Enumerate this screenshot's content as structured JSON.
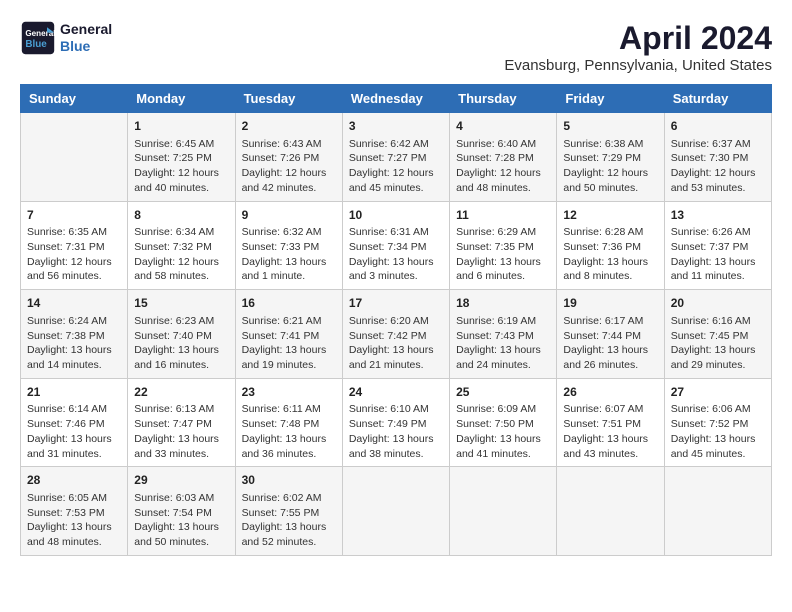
{
  "header": {
    "logo_line1": "General",
    "logo_line2": "Blue",
    "title": "April 2024",
    "subtitle": "Evansburg, Pennsylvania, United States"
  },
  "columns": [
    "Sunday",
    "Monday",
    "Tuesday",
    "Wednesday",
    "Thursday",
    "Friday",
    "Saturday"
  ],
  "weeks": [
    [
      {
        "day": "",
        "info": ""
      },
      {
        "day": "1",
        "info": "Sunrise: 6:45 AM\nSunset: 7:25 PM\nDaylight: 12 hours\nand 40 minutes."
      },
      {
        "day": "2",
        "info": "Sunrise: 6:43 AM\nSunset: 7:26 PM\nDaylight: 12 hours\nand 42 minutes."
      },
      {
        "day": "3",
        "info": "Sunrise: 6:42 AM\nSunset: 7:27 PM\nDaylight: 12 hours\nand 45 minutes."
      },
      {
        "day": "4",
        "info": "Sunrise: 6:40 AM\nSunset: 7:28 PM\nDaylight: 12 hours\nand 48 minutes."
      },
      {
        "day": "5",
        "info": "Sunrise: 6:38 AM\nSunset: 7:29 PM\nDaylight: 12 hours\nand 50 minutes."
      },
      {
        "day": "6",
        "info": "Sunrise: 6:37 AM\nSunset: 7:30 PM\nDaylight: 12 hours\nand 53 minutes."
      }
    ],
    [
      {
        "day": "7",
        "info": "Sunrise: 6:35 AM\nSunset: 7:31 PM\nDaylight: 12 hours\nand 56 minutes."
      },
      {
        "day": "8",
        "info": "Sunrise: 6:34 AM\nSunset: 7:32 PM\nDaylight: 12 hours\nand 58 minutes."
      },
      {
        "day": "9",
        "info": "Sunrise: 6:32 AM\nSunset: 7:33 PM\nDaylight: 13 hours\nand 1 minute."
      },
      {
        "day": "10",
        "info": "Sunrise: 6:31 AM\nSunset: 7:34 PM\nDaylight: 13 hours\nand 3 minutes."
      },
      {
        "day": "11",
        "info": "Sunrise: 6:29 AM\nSunset: 7:35 PM\nDaylight: 13 hours\nand 6 minutes."
      },
      {
        "day": "12",
        "info": "Sunrise: 6:28 AM\nSunset: 7:36 PM\nDaylight: 13 hours\nand 8 minutes."
      },
      {
        "day": "13",
        "info": "Sunrise: 6:26 AM\nSunset: 7:37 PM\nDaylight: 13 hours\nand 11 minutes."
      }
    ],
    [
      {
        "day": "14",
        "info": "Sunrise: 6:24 AM\nSunset: 7:38 PM\nDaylight: 13 hours\nand 14 minutes."
      },
      {
        "day": "15",
        "info": "Sunrise: 6:23 AM\nSunset: 7:40 PM\nDaylight: 13 hours\nand 16 minutes."
      },
      {
        "day": "16",
        "info": "Sunrise: 6:21 AM\nSunset: 7:41 PM\nDaylight: 13 hours\nand 19 minutes."
      },
      {
        "day": "17",
        "info": "Sunrise: 6:20 AM\nSunset: 7:42 PM\nDaylight: 13 hours\nand 21 minutes."
      },
      {
        "day": "18",
        "info": "Sunrise: 6:19 AM\nSunset: 7:43 PM\nDaylight: 13 hours\nand 24 minutes."
      },
      {
        "day": "19",
        "info": "Sunrise: 6:17 AM\nSunset: 7:44 PM\nDaylight: 13 hours\nand 26 minutes."
      },
      {
        "day": "20",
        "info": "Sunrise: 6:16 AM\nSunset: 7:45 PM\nDaylight: 13 hours\nand 29 minutes."
      }
    ],
    [
      {
        "day": "21",
        "info": "Sunrise: 6:14 AM\nSunset: 7:46 PM\nDaylight: 13 hours\nand 31 minutes."
      },
      {
        "day": "22",
        "info": "Sunrise: 6:13 AM\nSunset: 7:47 PM\nDaylight: 13 hours\nand 33 minutes."
      },
      {
        "day": "23",
        "info": "Sunrise: 6:11 AM\nSunset: 7:48 PM\nDaylight: 13 hours\nand 36 minutes."
      },
      {
        "day": "24",
        "info": "Sunrise: 6:10 AM\nSunset: 7:49 PM\nDaylight: 13 hours\nand 38 minutes."
      },
      {
        "day": "25",
        "info": "Sunrise: 6:09 AM\nSunset: 7:50 PM\nDaylight: 13 hours\nand 41 minutes."
      },
      {
        "day": "26",
        "info": "Sunrise: 6:07 AM\nSunset: 7:51 PM\nDaylight: 13 hours\nand 43 minutes."
      },
      {
        "day": "27",
        "info": "Sunrise: 6:06 AM\nSunset: 7:52 PM\nDaylight: 13 hours\nand 45 minutes."
      }
    ],
    [
      {
        "day": "28",
        "info": "Sunrise: 6:05 AM\nSunset: 7:53 PM\nDaylight: 13 hours\nand 48 minutes."
      },
      {
        "day": "29",
        "info": "Sunrise: 6:03 AM\nSunset: 7:54 PM\nDaylight: 13 hours\nand 50 minutes."
      },
      {
        "day": "30",
        "info": "Sunrise: 6:02 AM\nSunset: 7:55 PM\nDaylight: 13 hours\nand 52 minutes."
      },
      {
        "day": "",
        "info": ""
      },
      {
        "day": "",
        "info": ""
      },
      {
        "day": "",
        "info": ""
      },
      {
        "day": "",
        "info": ""
      }
    ]
  ]
}
